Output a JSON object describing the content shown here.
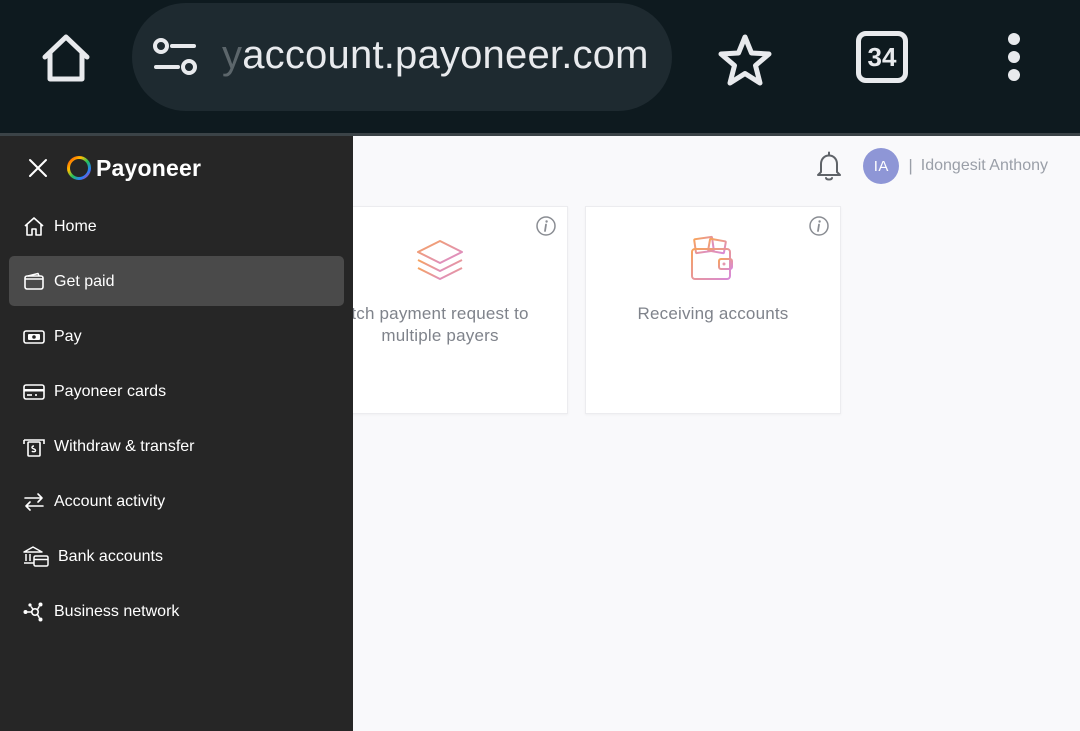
{
  "browser": {
    "url_faded": "y",
    "url_main": "account.payoneer.com",
    "tab_count": "34",
    "icons": [
      "home-icon",
      "site-settings-icon",
      "star-icon",
      "tabs-icon",
      "more-vert-icon"
    ]
  },
  "header": {
    "user_initials": "IA",
    "separator": "|",
    "user_name": "Idongesit Anthony",
    "avatar_color": "#8e96d6"
  },
  "cards": [
    {
      "label": "tch payment request to multiple payers",
      "icon": "layers-icon"
    },
    {
      "label": "Receiving accounts",
      "icon": "wallet-icon"
    }
  ],
  "sidenav": {
    "brand": "Payoneer",
    "items": [
      {
        "label": "Home",
        "icon": "home-outline-icon"
      },
      {
        "label": "Get paid",
        "icon": "wallet-outline-icon",
        "active": true
      },
      {
        "label": "Pay",
        "icon": "cash-icon"
      },
      {
        "label": "Payoneer cards",
        "icon": "card-icon"
      },
      {
        "label": "Withdraw & transfer",
        "icon": "atm-icon"
      },
      {
        "label": "Account activity",
        "icon": "transfer-arrows-icon"
      },
      {
        "label": "Bank accounts",
        "icon": "bank-icon"
      },
      {
        "label": "Business network",
        "icon": "network-icon"
      }
    ]
  },
  "colors": {
    "browser_bg": "#0e1a1f",
    "omnibox_bg": "#1e2a30",
    "sidenav_bg": "#262626",
    "active_item_bg": "#4a4a4a",
    "page_bg": "#f9f9fb"
  }
}
